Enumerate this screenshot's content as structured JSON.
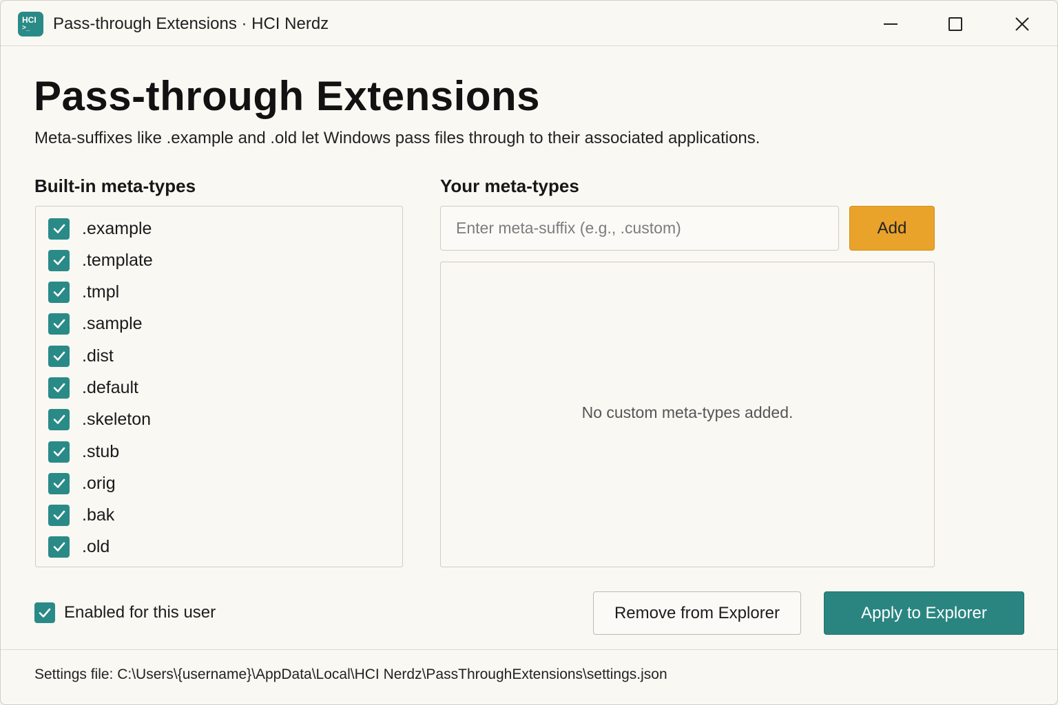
{
  "window": {
    "app_icon_text": "HCI",
    "app_icon_prompt": ">_",
    "title": "Pass-through Extensions · HCI Nerdz"
  },
  "header": {
    "title": "Pass-through Extensions",
    "subtitle": "Meta-suffixes like .example and .old let Windows pass files through to their associated applications."
  },
  "builtin": {
    "heading": "Built-in meta-types",
    "items": [
      {
        "label": ".example",
        "checked": true
      },
      {
        "label": ".template",
        "checked": true
      },
      {
        "label": ".tmpl",
        "checked": true
      },
      {
        "label": ".sample",
        "checked": true
      },
      {
        "label": ".dist",
        "checked": true
      },
      {
        "label": ".default",
        "checked": true
      },
      {
        "label": ".skeleton",
        "checked": true
      },
      {
        "label": ".stub",
        "checked": true
      },
      {
        "label": ".orig",
        "checked": true
      },
      {
        "label": ".bak",
        "checked": true
      },
      {
        "label": ".old",
        "checked": true
      }
    ]
  },
  "custom": {
    "heading": "Your meta-types",
    "input_value": "",
    "input_placeholder": "Enter meta-suffix (e.g., .custom)",
    "add_label": "Add",
    "empty_message": "No custom meta-types added."
  },
  "footer": {
    "enabled_label": "Enabled for this user",
    "enabled_checked": true,
    "remove_label": "Remove from Explorer",
    "apply_label": "Apply to Explorer"
  },
  "status": {
    "settings_path": "Settings file: C:\\Users\\{username}\\AppData\\Local\\HCI Nerdz\\PassThroughExtensions\\settings.json"
  },
  "colors": {
    "accent": "#2a8a87",
    "add_button": "#e9a22a",
    "background": "#faf8f3"
  }
}
